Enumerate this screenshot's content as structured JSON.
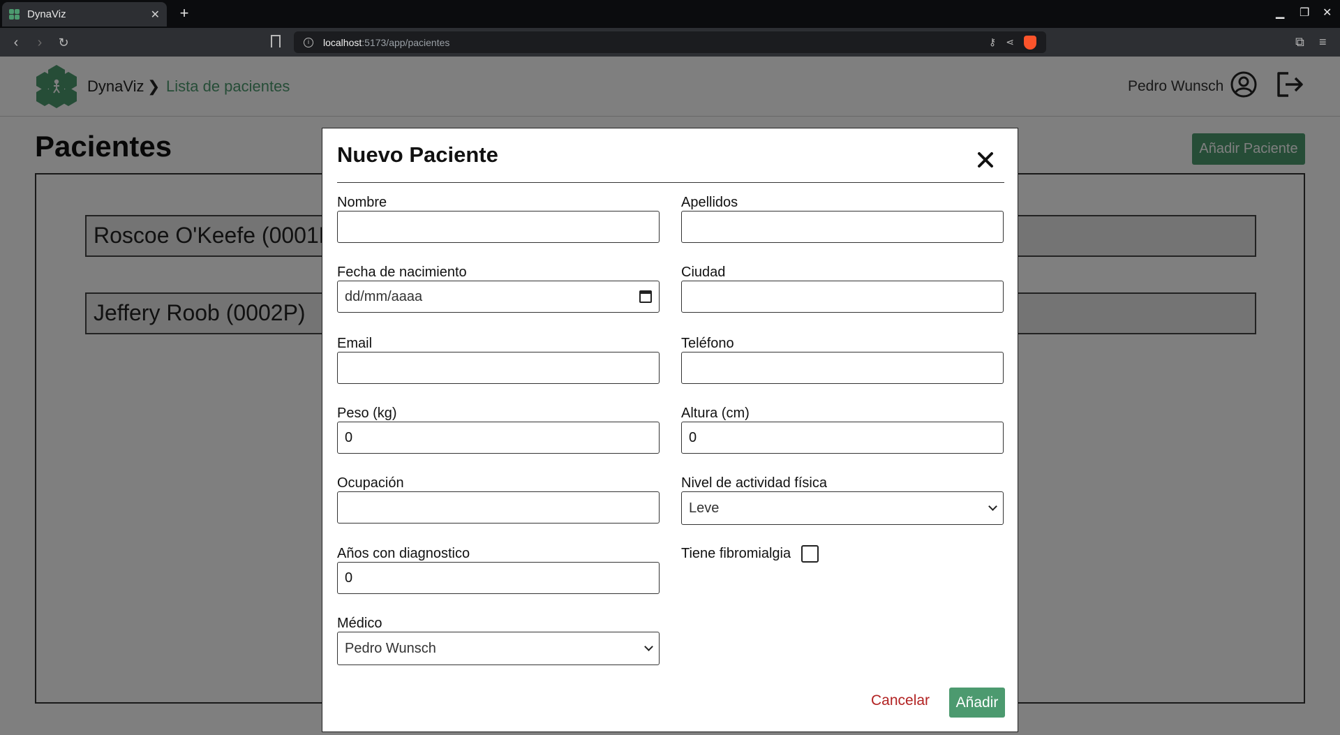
{
  "browser": {
    "tab_title": "DynaViz",
    "url_host": "localhost",
    "url_path": ":5173/app/pacientes"
  },
  "app": {
    "brand": "DynaViz",
    "breadcrumb_separator": "❯",
    "breadcrumb_current": "Lista de pacientes",
    "user_name": "Pedro Wunsch",
    "page_title": "Pacientes",
    "add_button": "Añadir Paciente",
    "accent_color": "#4c9a6f",
    "patients": [
      {
        "label": "Roscoe O'Keefe (0001P)"
      },
      {
        "label": "Jeffery Roob (0002P)"
      }
    ]
  },
  "modal": {
    "title": "Nuevo Paciente",
    "fields": {
      "nombre": {
        "label": "Nombre",
        "value": ""
      },
      "apellidos": {
        "label": "Apellidos",
        "value": ""
      },
      "fecha": {
        "label": "Fecha de nacimiento",
        "placeholder": "dd/mm/aaaa"
      },
      "ciudad": {
        "label": "Ciudad",
        "value": ""
      },
      "email": {
        "label": "Email",
        "value": ""
      },
      "telefono": {
        "label": "Teléfono",
        "value": ""
      },
      "peso": {
        "label": "Peso (kg)",
        "value": "0"
      },
      "altura": {
        "label": "Altura (cm)",
        "value": "0"
      },
      "ocupacion": {
        "label": "Ocupación",
        "value": ""
      },
      "actividad": {
        "label": "Nivel de actividad física",
        "selected": "Leve"
      },
      "anios": {
        "label": "Años con diagnostico",
        "value": "0"
      },
      "fibromialgia": {
        "label": "Tiene fibromialgia",
        "checked": false
      },
      "medico": {
        "label": "Médico",
        "selected": "Pedro Wunsch"
      }
    },
    "cancel_label": "Cancelar",
    "submit_label": "Añadir"
  }
}
